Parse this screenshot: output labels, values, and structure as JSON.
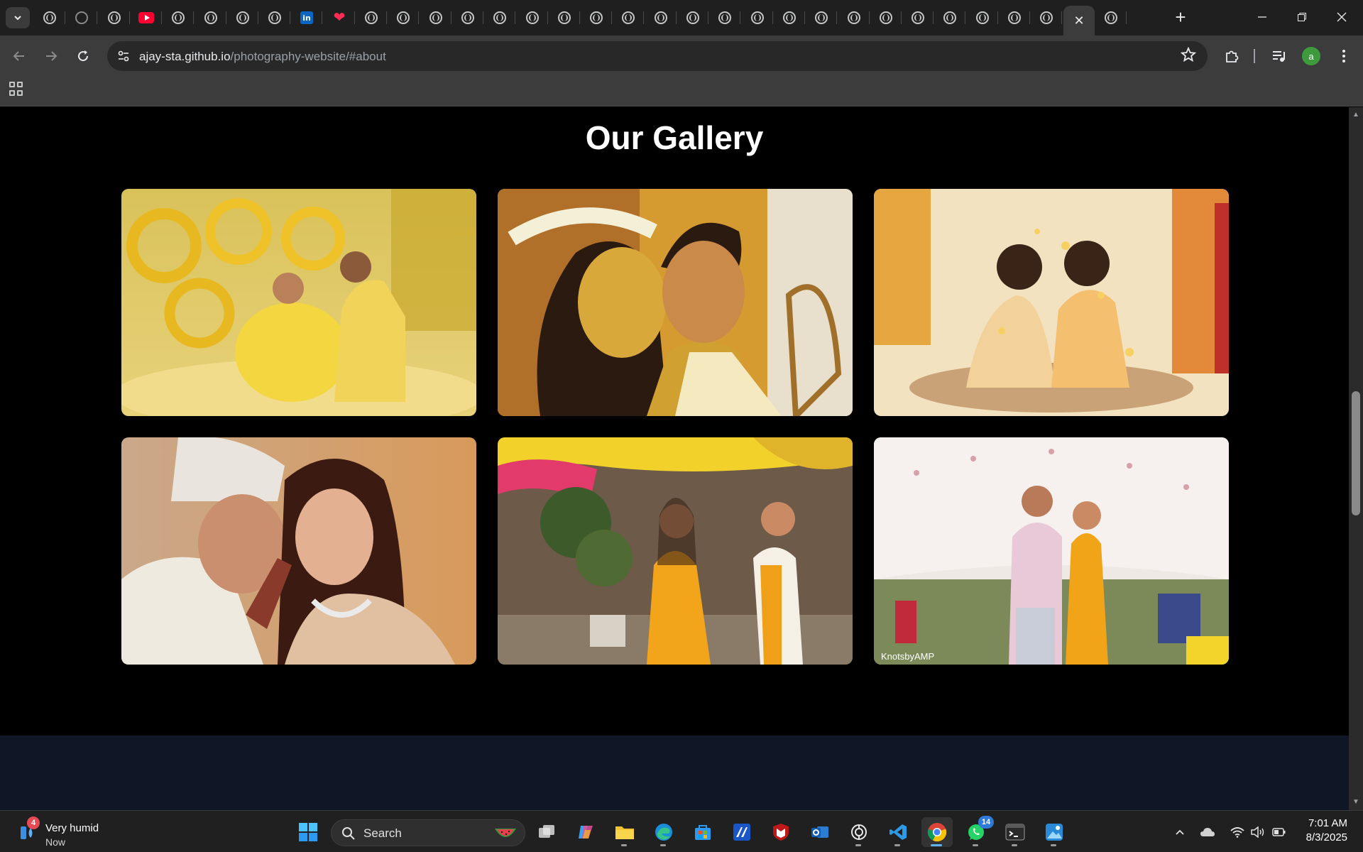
{
  "browser": {
    "tabs": [
      {
        "icon": "globe-icon"
      },
      {
        "icon": "github-icon"
      },
      {
        "icon": "globe-icon"
      },
      {
        "icon": "youtube-icon"
      },
      {
        "icon": "globe-icon"
      },
      {
        "icon": "globe-icon"
      },
      {
        "icon": "globe-icon"
      },
      {
        "icon": "globe-icon"
      },
      {
        "icon": "linkedin-icon"
      },
      {
        "icon": "heart-icon"
      },
      {
        "icon": "globe-icon"
      },
      {
        "icon": "globe-icon"
      },
      {
        "icon": "globe-icon"
      },
      {
        "icon": "globe-icon"
      },
      {
        "icon": "globe-icon"
      },
      {
        "icon": "globe-icon"
      },
      {
        "icon": "globe-icon"
      },
      {
        "icon": "globe-icon"
      },
      {
        "icon": "globe-icon"
      },
      {
        "icon": "globe-icon"
      },
      {
        "icon": "globe-icon"
      },
      {
        "icon": "globe-icon"
      },
      {
        "icon": "globe-icon"
      },
      {
        "icon": "globe-icon"
      },
      {
        "icon": "globe-icon"
      },
      {
        "icon": "globe-icon"
      },
      {
        "icon": "globe-icon"
      },
      {
        "icon": "globe-icon"
      },
      {
        "icon": "globe-icon"
      },
      {
        "icon": "globe-icon"
      },
      {
        "icon": "globe-icon"
      },
      {
        "icon": "globe-icon"
      },
      {
        "icon": "close-icon",
        "active": true
      },
      {
        "icon": "globe-icon"
      }
    ],
    "linkedin_glyph": "in",
    "address": {
      "host": "ajay-sta.github.io",
      "path": "/photography-website/#about"
    },
    "profile_initial": "a"
  },
  "page": {
    "heading": "Our Gallery",
    "gallery": [
      {
        "caption": "",
        "theme": "haldi-garden"
      },
      {
        "caption": "",
        "theme": "haldi-closeup"
      },
      {
        "caption": "",
        "theme": "haldi-petals"
      },
      {
        "caption": "",
        "theme": "wedding-portrait"
      },
      {
        "caption": "",
        "theme": "mehendi-couple"
      },
      {
        "caption": "KnotsbyAMP",
        "theme": "tent-couple"
      }
    ]
  },
  "taskbar": {
    "weather": {
      "badge": "4",
      "title": "Very humid",
      "subtitle": "Now"
    },
    "search_label": "Search",
    "whatsapp_badge": "14",
    "clock": {
      "time": "7:01 AM",
      "date": "8/3/2025"
    }
  },
  "colors": {
    "accent": "#5fb2f2",
    "page_bg": "#000000",
    "footer_bg": "#0f1626"
  }
}
